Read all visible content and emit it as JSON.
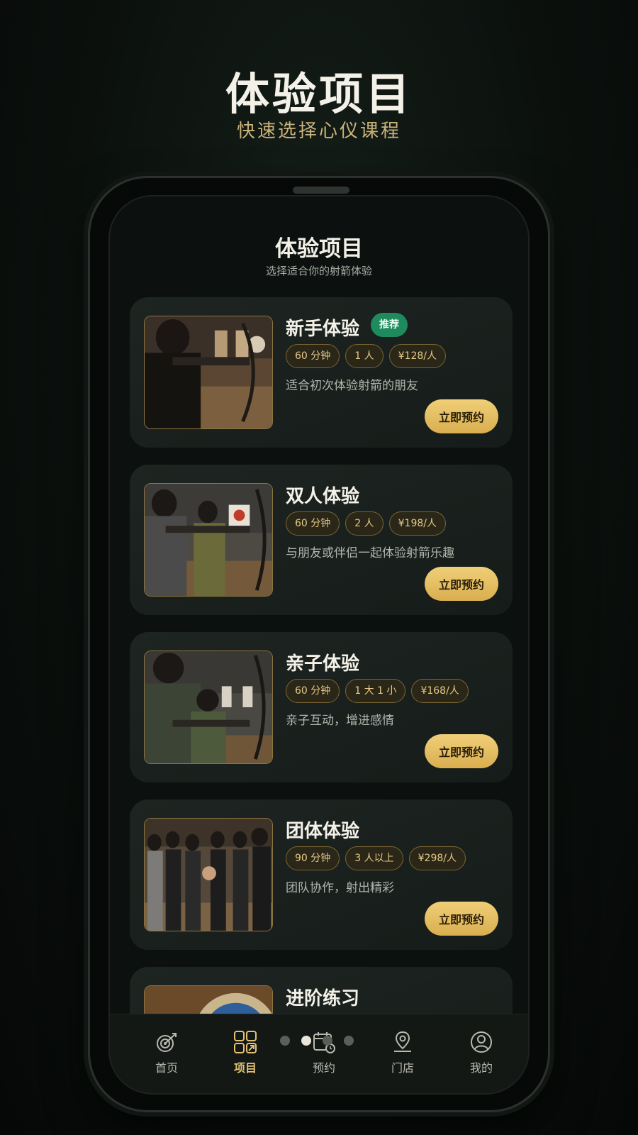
{
  "hero": {
    "title": "体验项目",
    "subtitle": "快速选择心仪课程"
  },
  "screen": {
    "title": "体验项目",
    "subtitle": "选择适合你的射箭体验"
  },
  "cards": [
    {
      "title": "新手体验",
      "badge": "推荐",
      "tags": [
        "60 分钟",
        "1 人",
        "¥128/人"
      ],
      "desc": "适合初次体验射箭的朋友",
      "button": "立即预约"
    },
    {
      "title": "双人体验",
      "tags": [
        "60 分钟",
        "2 人",
        "¥198/人"
      ],
      "desc": "与朋友或伴侣一起体验射箭乐趣",
      "button": "立即预约"
    },
    {
      "title": "亲子体验",
      "tags": [
        "60 分钟",
        "1 大 1 小",
        "¥168/人"
      ],
      "desc": "亲子互动，增进感情",
      "button": "立即预约"
    },
    {
      "title": "团体体验",
      "tags": [
        "90 分钟",
        "3 人以上",
        "¥298/人"
      ],
      "desc": "团队协作，射出精彩",
      "button": "立即预约"
    },
    {
      "title": "进阶练习"
    }
  ],
  "nav": [
    {
      "label": "首页",
      "icon": "target-icon"
    },
    {
      "label": "项目",
      "icon": "grid-icon",
      "active": true
    },
    {
      "label": "预约",
      "icon": "calendar-icon"
    },
    {
      "label": "门店",
      "icon": "location-icon"
    },
    {
      "label": "我的",
      "icon": "user-icon"
    }
  ],
  "pager": {
    "count": 4,
    "current": 2
  },
  "colors": {
    "accent": "#e4c173",
    "badge": "#1f8a5e",
    "background": "#0c100e"
  }
}
